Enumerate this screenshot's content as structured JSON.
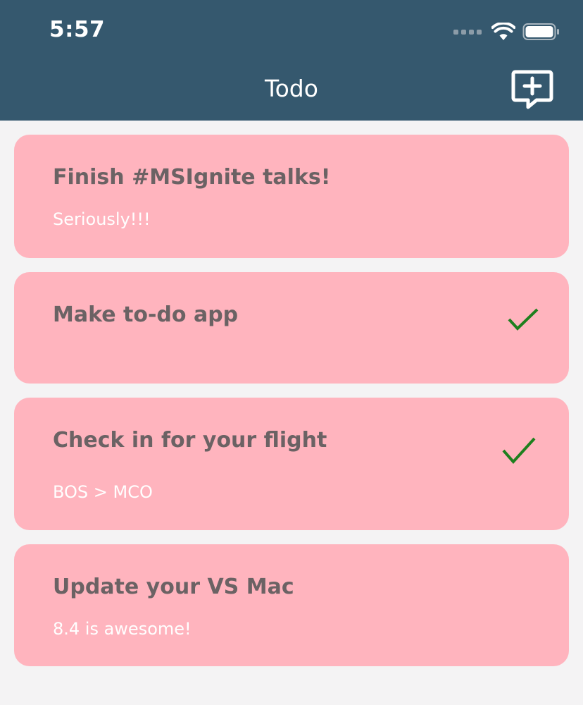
{
  "status_bar": {
    "time": "5:57",
    "icons": [
      "cellular-signal-icon",
      "wifi-icon",
      "battery-icon"
    ]
  },
  "nav": {
    "title": "Todo",
    "add_icon": "add-comment-icon"
  },
  "colors": {
    "header_bg": "#35586e",
    "page_bg": "#f4f3f4",
    "card_bg": "#ffb4be",
    "title_text": "#6b6264",
    "subtitle_text": "#ffffff",
    "check": "#1e7f1e"
  },
  "todos": [
    {
      "title": "Finish #MSIgnite talks!",
      "subtitle": "Seriously!!!",
      "done": false
    },
    {
      "title": "Make to-do app",
      "subtitle": "",
      "done": true
    },
    {
      "title": "Check in for your flight",
      "subtitle": "BOS > MCO",
      "done": true
    },
    {
      "title": "Update your VS Mac",
      "subtitle": "8.4 is awesome!",
      "done": false
    }
  ]
}
